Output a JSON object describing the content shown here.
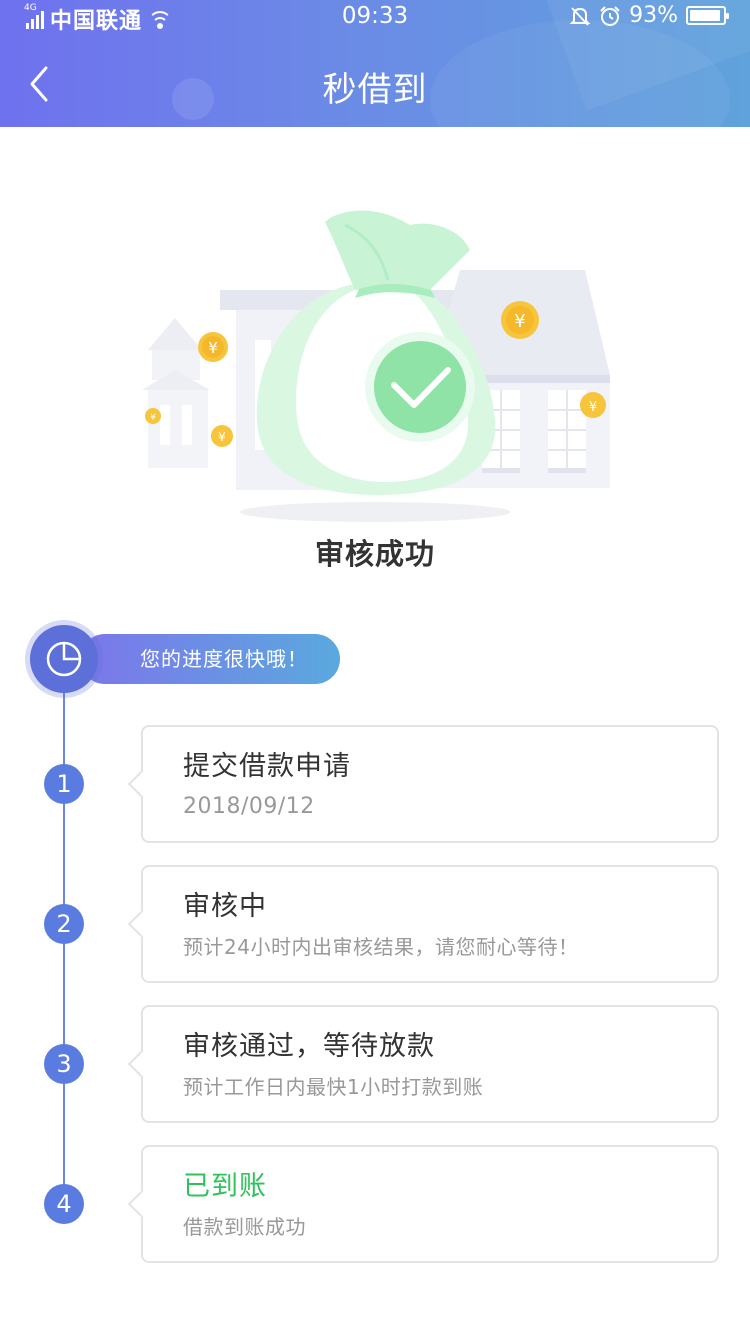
{
  "status_bar": {
    "network": "4G",
    "carrier": "中国联通",
    "time": "09:33",
    "battery_percent": "93%",
    "battery_level": 0.93
  },
  "nav": {
    "title": "秒借到",
    "back_icon": "chevron-left-icon"
  },
  "result": {
    "title": "审核成功",
    "illustration_icon": "money-bag-check-icon"
  },
  "progress": {
    "tip": "您的进度很快哦！",
    "icon": "pie-clock-icon"
  },
  "steps": [
    {
      "number": "1",
      "title": "提交借款申请",
      "subtitle": "2018/09/12"
    },
    {
      "number": "2",
      "title": "审核中",
      "subtitle": "预计24小时内出审核结果，请您耐心等待！"
    },
    {
      "number": "3",
      "title": "审核通过，等待放款",
      "subtitle": "预计工作日内最快1小时打款到账"
    },
    {
      "number": "4",
      "title": "已到账",
      "subtitle": "借款到账成功"
    }
  ],
  "colors": {
    "header_start": "#6f71ee",
    "header_end": "#5fa2dc",
    "timeline": "#5a7ce0",
    "success_green": "#2fc25b",
    "check_green": "#6cd98a"
  }
}
